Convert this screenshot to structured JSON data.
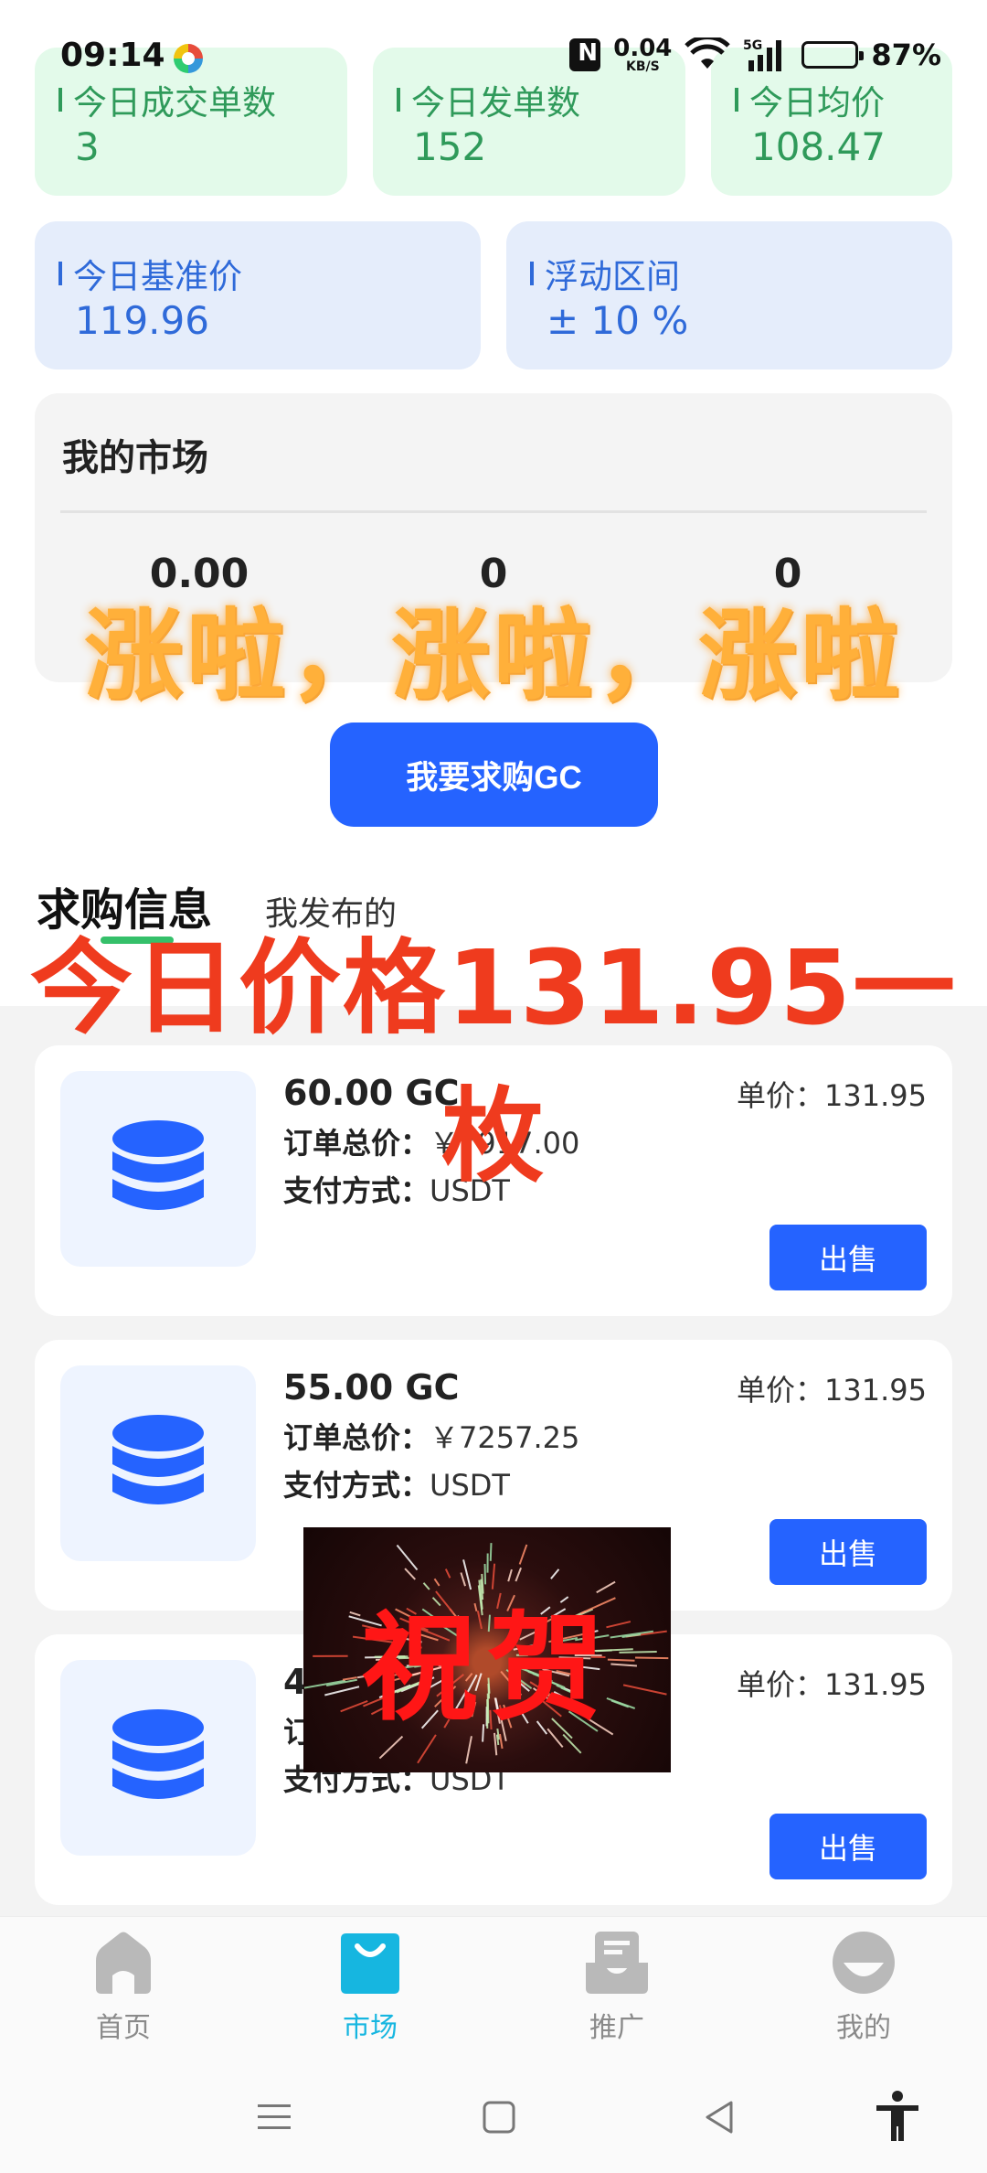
{
  "status_bar": {
    "time": "09:14",
    "net_speed_value": "0.04",
    "net_speed_unit": "KB/S",
    "network_type": "5G",
    "battery_percent": "87%",
    "battery_level": 0.87
  },
  "stats": {
    "row1": [
      {
        "label": "今日成交单数",
        "value": "3"
      },
      {
        "label": "今日发单数",
        "value": "152"
      },
      {
        "label": "今日均价",
        "value": "108.47"
      }
    ],
    "row2": [
      {
        "label": "今日基准价",
        "value": "119.96"
      },
      {
        "label": "浮动区间",
        "value": "± 10 %"
      }
    ]
  },
  "market": {
    "title": "我的市场",
    "items": [
      {
        "value": "0.00"
      },
      {
        "value": "0"
      },
      {
        "value": "0"
      }
    ]
  },
  "overlays": {
    "cheer": "涨啦，涨啦，涨啦",
    "price": "今日价格131.95一枚",
    "celebrate": "祝贺"
  },
  "buy_button": "我要求购GC",
  "tabs": {
    "active": "求购信息",
    "inactive": "我发布的"
  },
  "orders": [
    {
      "amount": "60.00 GC",
      "total_label": "订单总价：",
      "total": "￥7917.00",
      "pay_label": "支付方式：",
      "pay": "USDT",
      "unit_label": "单价：",
      "unit": "131.95",
      "action": "出售"
    },
    {
      "amount": "55.00 GC",
      "total_label": "订单总价：",
      "total": "￥7257.25",
      "pay_label": "支付方式：",
      "pay": "USDT",
      "unit_label": "单价：",
      "unit": "131.95",
      "action": "出售"
    },
    {
      "amount": "4",
      "total_label": "订",
      "total": "",
      "pay_label": "支付方式：",
      "pay": "USDT",
      "unit_label": "单价：",
      "unit": "131.95",
      "action": "出售"
    }
  ],
  "nav": [
    {
      "label": "首页",
      "icon": "home-icon"
    },
    {
      "label": "市场",
      "icon": "shopping-bag-icon"
    },
    {
      "label": "推广",
      "icon": "mail-tray-icon"
    },
    {
      "label": "我的",
      "icon": "profile-icon"
    }
  ],
  "colors": {
    "primary": "#2563ff",
    "green_card": "#e3faea",
    "blue_card": "#e5edfb",
    "nav_active": "#16b6e0",
    "overlay_price": "#ef3b1e",
    "overlay_cheer": "#ffb03a"
  }
}
